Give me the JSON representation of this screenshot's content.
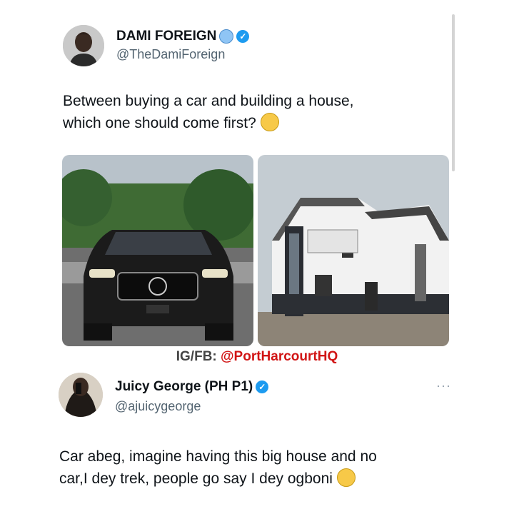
{
  "tweet": {
    "author_name": "DAMI FOREIGN",
    "author_handle": "@TheDamiForeign",
    "text_line1": "Between buying a car and building a house,",
    "text_line2": "which one should come first?",
    "emoji_icon": "thinking-face-icon"
  },
  "watermark": {
    "prefix": "IG/FB: ",
    "handle": "@PortHarcourtHQ",
    "color": "#d11515"
  },
  "reply": {
    "author_name": "Juicy George (PH P1)",
    "author_handle": "@ajuicygeorge",
    "more_label": "···",
    "text_line1": "Car abeg, imagine having this big house and no",
    "text_line2": "car,I dey trek, people go say I dey ogboni",
    "emoji_icon": "crying-face-icon"
  },
  "colors": {
    "verified_badge": "#1d9bf0",
    "handle": "#536471"
  }
}
